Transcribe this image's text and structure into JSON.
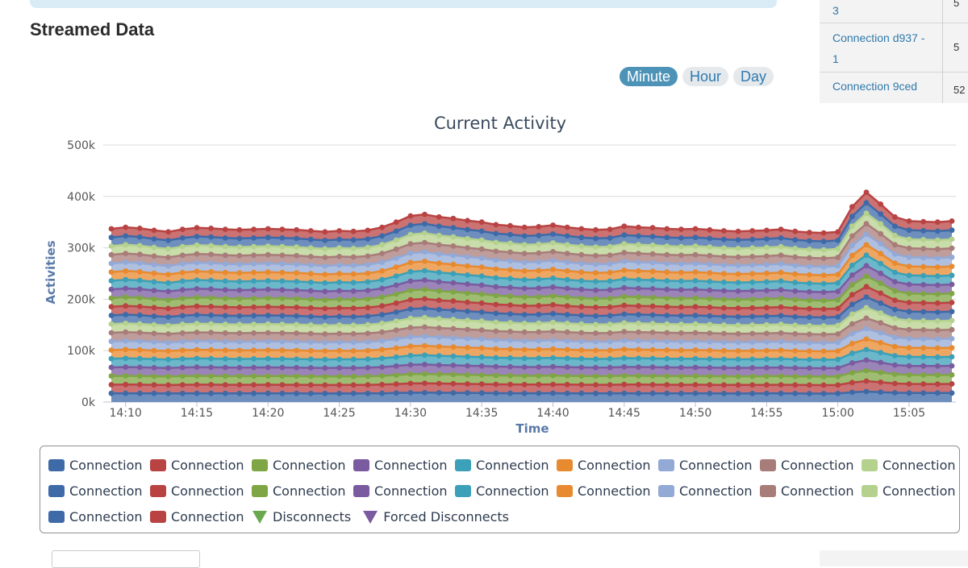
{
  "page": {
    "section_title": "Streamed Data",
    "range_buttons": [
      {
        "label": "Minute",
        "active": true
      },
      {
        "label": "Hour",
        "active": false
      },
      {
        "label": "Day",
        "active": false
      }
    ]
  },
  "side_table": {
    "rows": [
      {
        "name": "3",
        "value": "5"
      },
      {
        "name": "Connection d937 - 1",
        "value": "5"
      },
      {
        "name": "Connection 9ced",
        "value": "52"
      }
    ]
  },
  "chart_data": {
    "type": "area",
    "stacked": true,
    "title": "Current Activity",
    "xlabel": "Time",
    "ylabel": "Activities",
    "ylim": [
      0,
      500000
    ],
    "yticks": [
      "0k",
      "100k",
      "200k",
      "300k",
      "400k",
      "500k"
    ],
    "x_tick_labels": [
      "14:10",
      "14:15",
      "14:20",
      "14:25",
      "14:30",
      "14:35",
      "14:40",
      "14:45",
      "14:50",
      "14:55",
      "15:00",
      "15:05"
    ],
    "x_start_time": "14:09",
    "x_end_time": "15:08",
    "minute_step": 1,
    "grid": true,
    "legend_placement": "bottom",
    "totals": [
      337000,
      340000,
      338000,
      334000,
      331000,
      336000,
      339000,
      338000,
      336000,
      335000,
      336000,
      337000,
      336000,
      335000,
      333000,
      331000,
      333000,
      332000,
      334000,
      340000,
      350000,
      362000,
      365000,
      360000,
      357000,
      353000,
      350000,
      345000,
      343000,
      340000,
      341000,
      344000,
      340000,
      337000,
      335000,
      336000,
      342000,
      340000,
      339000,
      337000,
      336000,
      337000,
      335000,
      333000,
      332000,
      333000,
      334000,
      336000,
      332000,
      330000,
      329000,
      331000,
      380000,
      408000,
      385000,
      360000,
      352000,
      351000,
      350000,
      352000
    ],
    "series": [
      {
        "name": "Connection",
        "color": "#3e6aa8",
        "weights": [
          1,
          1,
          1,
          1,
          1,
          1,
          1,
          1,
          1,
          1,
          1,
          1,
          1,
          1,
          1,
          1,
          1,
          1,
          1,
          1,
          1,
          1,
          1,
          1,
          1,
          1,
          1,
          1,
          1,
          1,
          1,
          1,
          1,
          1,
          1,
          1,
          1,
          1,
          1,
          1,
          1,
          1,
          1,
          1,
          1,
          1,
          1,
          1,
          1,
          1,
          1,
          1,
          1,
          1,
          1,
          1,
          1,
          1,
          1,
          1
        ]
      },
      {
        "name": "Connection",
        "color": "#b94343"
      },
      {
        "name": "Connection",
        "color": "#7fa644"
      },
      {
        "name": "Connection",
        "color": "#7a5ba0"
      },
      {
        "name": "Connection",
        "color": "#3ba0b8"
      },
      {
        "name": "Connection",
        "color": "#e88a2f"
      },
      {
        "name": "Connection",
        "color": "#93a9d6"
      },
      {
        "name": "Connection",
        "color": "#a87c79"
      },
      {
        "name": "Connection",
        "color": "#b5d18e"
      },
      {
        "name": "Connection",
        "color": "#3e6aa8"
      },
      {
        "name": "Connection",
        "color": "#b94343"
      },
      {
        "name": "Connection",
        "color": "#7fa644"
      },
      {
        "name": "Connection",
        "color": "#7a5ba0"
      },
      {
        "name": "Connection",
        "color": "#3ba0b8"
      },
      {
        "name": "Connection",
        "color": "#e88a2f"
      },
      {
        "name": "Connection",
        "color": "#93a9d6"
      },
      {
        "name": "Connection",
        "color": "#a87c79"
      },
      {
        "name": "Connection",
        "color": "#b5d18e"
      },
      {
        "name": "Connection",
        "color": "#3e6aa8"
      },
      {
        "name": "Connection",
        "color": "#b94343"
      }
    ],
    "extra_legend": [
      {
        "name": "Disconnects",
        "color": "#6aa84f",
        "marker": "triangle-down"
      },
      {
        "name": "Forced Disconnects",
        "color": "#7a5ba0",
        "marker": "triangle-down"
      }
    ]
  }
}
